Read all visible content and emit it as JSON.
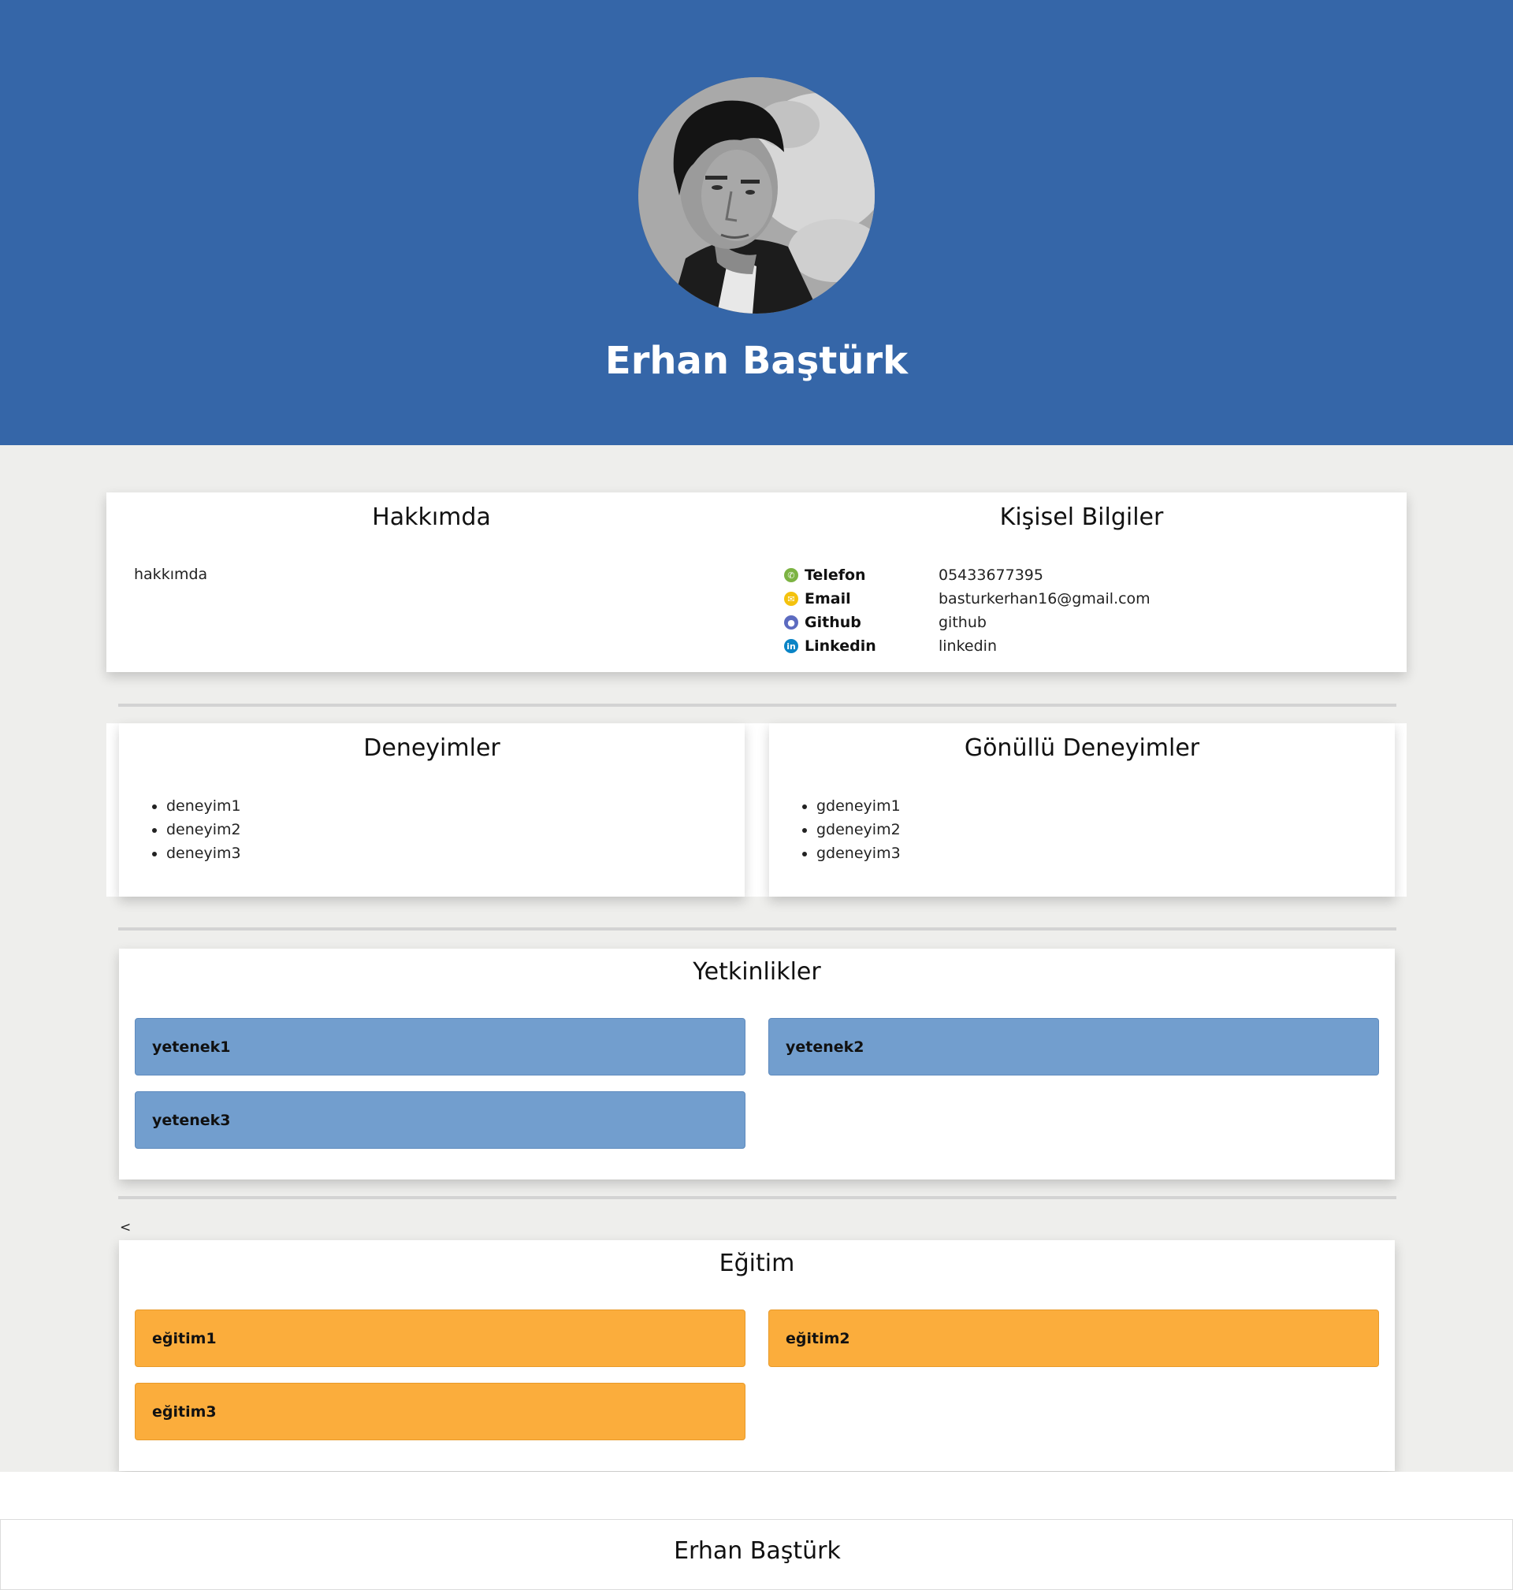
{
  "header": {
    "name": "Erhan Baştürk",
    "avatar_alt": "profile photo"
  },
  "about": {
    "title": "Hakkımda",
    "text": "hakkımda"
  },
  "personal": {
    "title": "Kişisel Bilgiler",
    "rows": [
      {
        "icon": "phone-icon",
        "label": "Telefon",
        "value": "05433677395",
        "color": "#7cb342"
      },
      {
        "icon": "email-icon",
        "label": "Email",
        "value": "basturkerhan16@gmail.com",
        "color": "#f4c20d"
      },
      {
        "icon": "github-icon",
        "label": "Github",
        "value": "github",
        "color": "#5c6bc0"
      },
      {
        "icon": "linkedin-icon",
        "label": "Linkedin",
        "value": "linkedin",
        "color": "#0a84c6"
      }
    ]
  },
  "experience": {
    "title": "Deneyimler",
    "items": [
      "deneyim1",
      "deneyim2",
      "deneyim3"
    ]
  },
  "volunteer": {
    "title": "Gönüllü Deneyimler",
    "items": [
      "gdeneyim1",
      "gdeneyim2",
      "gdeneyim3"
    ]
  },
  "skills": {
    "title": "Yetkinlikler",
    "items": [
      "yetenek1",
      "yetenek2",
      "yetenek3"
    ],
    "color": "#729ece"
  },
  "stray_char": "<",
  "education": {
    "title": "Eğitim",
    "items": [
      "eğitim1",
      "eğitim2",
      "eğitim3"
    ],
    "color": "#fbad3c"
  },
  "footer": {
    "name": "Erhan Baştürk"
  },
  "colors": {
    "hero_bg": "#3566a8",
    "page_bg": "#eeeeec"
  }
}
